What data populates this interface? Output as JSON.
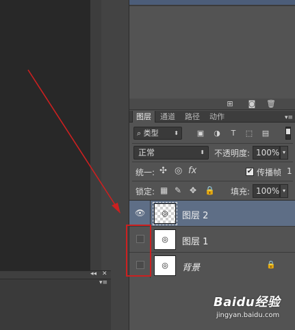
{
  "tabs": [
    {
      "label": "图层",
      "active": true
    },
    {
      "label": "通道",
      "active": false
    },
    {
      "label": "路径",
      "active": false
    },
    {
      "label": "动作",
      "active": false
    }
  ],
  "filter": {
    "kind_label": "类型"
  },
  "blend": {
    "mode": "正常",
    "opacity_label": "不透明度:",
    "opacity_value": "100%"
  },
  "unify": {
    "label": "统一:",
    "propagate_label": "传播帧",
    "propagate_value": "1",
    "propagate_checked": true
  },
  "lock": {
    "label": "锁定:",
    "fill_label": "填充:",
    "fill_value": "100%"
  },
  "layers": [
    {
      "name": "图层 2",
      "visible": true,
      "selected": true,
      "transparent": true,
      "locked": false
    },
    {
      "name": "图层 1",
      "visible": false,
      "selected": false,
      "transparent": false,
      "locked": false
    },
    {
      "name": "背景",
      "visible": false,
      "selected": false,
      "transparent": false,
      "locked": true
    }
  ],
  "annotation": {
    "arrow_color": "#cc2020",
    "box_color": "#cc2020"
  },
  "watermark": {
    "brand": "Baidu经验",
    "url": "jingyan.baidu.com"
  },
  "colors": {
    "panel_bg": "#535353",
    "selected_row": "#5e6e86",
    "canvas_bg": "#282828"
  }
}
